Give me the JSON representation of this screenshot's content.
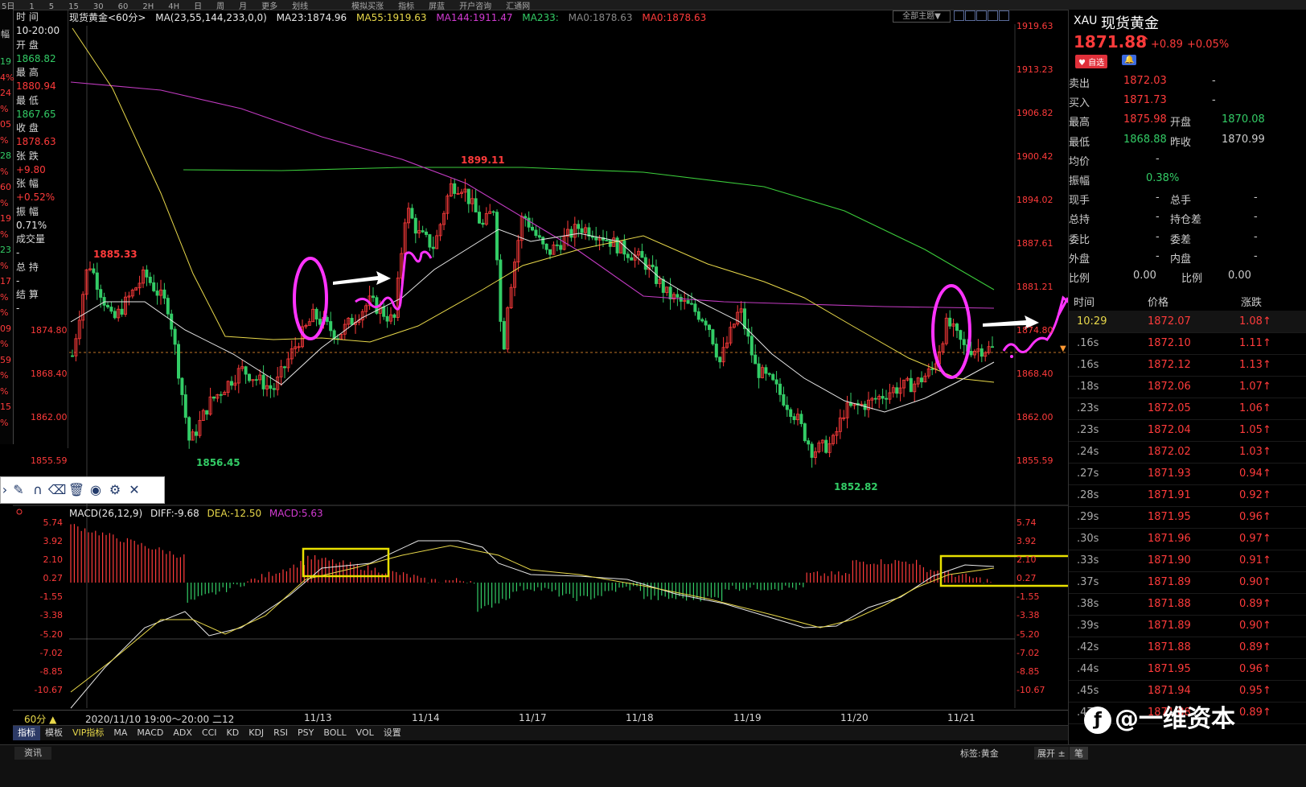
{
  "topbar": {
    "items": [
      "5日",
      "1",
      "5",
      "15",
      "30",
      "60",
      "2H",
      "4H",
      "日",
      "周",
      "月",
      "更多",
      "划线",
      "",
      "",
      "模拟买涨",
      "指标",
      "屏蓝",
      "开户咨询",
      "汇通网"
    ]
  },
  "left_panel": {
    "rows": [
      {
        "label": "时 间",
        "value": "10-20:00",
        "vclass": "white"
      },
      {
        "label": "开 盘",
        "value": "1868.82",
        "vclass": "green"
      },
      {
        "label": "最 高",
        "value": "1880.94",
        "vclass": "red"
      },
      {
        "label": "最 低",
        "value": "1867.65",
        "vclass": "green"
      },
      {
        "label": "收 盘",
        "value": "1878.63",
        "vclass": "red"
      },
      {
        "label": "张 跌",
        "value": "+9.80",
        "vclass": "red"
      },
      {
        "label": "张 幅",
        "value": "+0.52%",
        "vclass": "red"
      },
      {
        "label": "振 幅",
        "value": "0.71%",
        "vclass": "white"
      },
      {
        "label": "成交量",
        "value": "-",
        "vclass": "white"
      },
      {
        "label": "总 持",
        "value": "-",
        "vclass": "white"
      },
      {
        "label": "结 算",
        "value": "-",
        "vclass": "white"
      }
    ],
    "strip_label": "幅",
    "strip_values": [
      "19",
      "4%",
      "24",
      "%",
      "05",
      "%",
      "28",
      "%",
      "60",
      "%",
      "19",
      "%",
      "23",
      "%",
      "17",
      "%",
      "%",
      "09",
      "%",
      "59",
      "%",
      "%",
      "15",
      "%"
    ]
  },
  "ma_legend": {
    "symbol": "现货黄金<60分>",
    "ma": "MA(23,55,144,233,0,0)",
    "ma23": "MA23:1874.96",
    "ma55": "MA55:1919.63",
    "ma144": "MA144:1911.47",
    "ma233": "MA233:",
    "ma0a": "MA0:1878.63",
    "ma0b": "MA0:1878.63",
    "theme": "全部主题▼"
  },
  "price_axis": [
    "1919.63",
    "1913.23",
    "1906.82",
    "1900.42",
    "1894.02",
    "1887.61",
    "1881.21",
    "1874.80",
    "1868.40",
    "1862.00",
    "1855.59"
  ],
  "left_axis_extra": [
    "1874.80",
    "1868.40",
    "1862.00",
    "1855.59"
  ],
  "annotations": {
    "high": "1899.11",
    "high_left": "1885.33",
    "low1": "1856.45",
    "low2": "1852.82"
  },
  "macd_legend": {
    "name": "MACD(26,12,9)",
    "diff": "DIFF:-9.68",
    "dea": "DEA:-12.50",
    "macd": "MACD:5.63"
  },
  "macd_axis": [
    "5.74",
    "3.92",
    "2.10",
    "0.27",
    "-1.55",
    "-3.38",
    "-5.20",
    "-7.02",
    "-8.85",
    "-10.67"
  ],
  "date_axis": {
    "period": "60分 ▲",
    "cursor": "2020/11/10 19:00～20:00 二12",
    "dates": [
      "11/13",
      "11/14",
      "11/17",
      "11/18",
      "11/19",
      "11/20",
      "11/21"
    ]
  },
  "tabs": [
    "指标",
    "模板",
    "VIP指标",
    "MA",
    "MACD",
    "ADX",
    "CCI",
    "KD",
    "KDJ",
    "RSI",
    "PSY",
    "BOLL",
    "VOL",
    "设置"
  ],
  "bottom": {
    "left": "资讯",
    "tag": "标签:黄金",
    "expand": "展开 ±",
    "pen": "笔"
  },
  "quote": {
    "code": "XAU",
    "name": "现货黄金",
    "price": "1871.88",
    "arrow": "↑",
    "change": "+0.89",
    "pct": "+0.05%",
    "fav": "♥ 自选",
    "bell": "🔔",
    "sell_label": "卖出",
    "sell": "1872.03",
    "sell_vol": "-",
    "buy_label": "买入",
    "buy": "1871.73",
    "buy_vol": "-",
    "high_label": "最高",
    "high": "1875.98",
    "open_label": "开盘",
    "open": "1870.08",
    "low_label": "最低",
    "low": "1868.88",
    "prev_label": "昨收",
    "prev": "1870.99",
    "avg_label": "均价",
    "avg": "-",
    "amp_label": "振幅",
    "amp": "0.38%",
    "cur_label": "现手",
    "cur": "-",
    "total_label": "总手",
    "total": "-",
    "hold_label": "总持",
    "hold": "-",
    "hold_diff_label": "持仓差",
    "hold_diff": "-",
    "ratio_label": "委比",
    "ratio": "-",
    "diff_label": "委差",
    "diff": "-",
    "outer_label": "外盘",
    "outer": "-",
    "inner_label": "内盘",
    "inner": "-",
    "prop_label": "比例",
    "prop1": "0.00",
    "prop2_label": "比例",
    "prop2": "0.00"
  },
  "ticks_header": {
    "time": "时间",
    "price": "价格",
    "chg": "涨跌"
  },
  "ticks": [
    {
      "t": "10:29",
      "p": "1872.07",
      "c": "1.08↑"
    },
    {
      "t": ".16s",
      "p": "1872.10",
      "c": "1.11↑"
    },
    {
      "t": ".16s",
      "p": "1872.12",
      "c": "1.13↑"
    },
    {
      "t": ".18s",
      "p": "1872.06",
      "c": "1.07↑"
    },
    {
      "t": ".23s",
      "p": "1872.05",
      "c": "1.06↑"
    },
    {
      "t": ".23s",
      "p": "1872.04",
      "c": "1.05↑"
    },
    {
      "t": ".24s",
      "p": "1872.02",
      "c": "1.03↑"
    },
    {
      "t": ".27s",
      "p": "1871.93",
      "c": "0.94↑"
    },
    {
      "t": ".28s",
      "p": "1871.91",
      "c": "0.92↑"
    },
    {
      "t": ".29s",
      "p": "1871.95",
      "c": "0.96↑"
    },
    {
      "t": ".30s",
      "p": "1871.96",
      "c": "0.97↑"
    },
    {
      "t": ".33s",
      "p": "1871.90",
      "c": "0.91↑"
    },
    {
      "t": ".37s",
      "p": "1871.89",
      "c": "0.90↑"
    },
    {
      "t": ".38s",
      "p": "1871.88",
      "c": "0.89↑"
    },
    {
      "t": ".39s",
      "p": "1871.89",
      "c": "0.90↑"
    },
    {
      "t": ".42s",
      "p": "1871.88",
      "c": "0.89↑"
    },
    {
      "t": ".44s",
      "p": "1871.95",
      "c": "0.96↑"
    },
    {
      "t": ".45s",
      "p": "1871.94",
      "c": "0.95↑"
    },
    {
      "t": ".47s",
      "p": "1871.88",
      "c": "0.89↑"
    }
  ],
  "watermark": "@一维资本",
  "colors": {
    "up": "#ff3b3b",
    "down": "#33cc66",
    "ma23": "#e8e8e8",
    "ma55": "#e8d84a",
    "ma144": "#c23bc2",
    "ma233": "#3bcc3b",
    "annot": "#ff33ff",
    "box": "#e8e000"
  }
}
